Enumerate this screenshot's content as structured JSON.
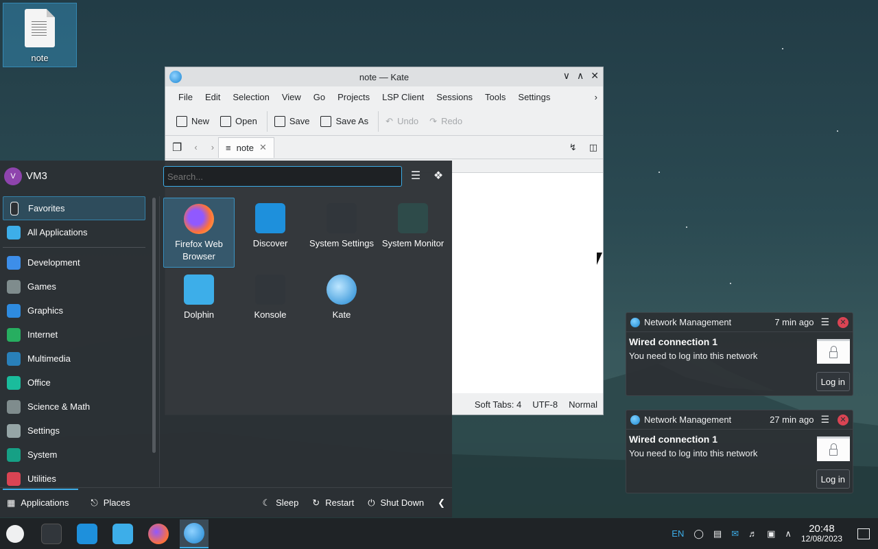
{
  "desktop": {
    "icon_label": "note"
  },
  "kate": {
    "title": "note — Kate",
    "menus": [
      "File",
      "Edit",
      "Selection",
      "View",
      "Go",
      "Projects",
      "LSP Client",
      "Sessions",
      "Tools",
      "Settings"
    ],
    "toolbar": {
      "new": "New",
      "open": "Open",
      "save": "Save",
      "save_as": "Save As",
      "undo": "Undo",
      "redo": "Redo"
    },
    "tab": "note",
    "status": {
      "tabs": "Soft Tabs: 4",
      "encoding": "UTF-8",
      "mode": "Normal"
    }
  },
  "launcher": {
    "user": "VM3",
    "avatar_letter": "V",
    "search_placeholder": "Search...",
    "categories": [
      {
        "label": "Favorites",
        "icon": "bookmark-icon",
        "color": "#2c3034"
      },
      {
        "label": "All Applications",
        "icon": "grid-icon",
        "color": "#3daee9"
      },
      {
        "label": "Development",
        "icon": "code-icon",
        "color": "#3d8ee9"
      },
      {
        "label": "Games",
        "icon": "gamepad-icon",
        "color": "#7f8c8d"
      },
      {
        "label": "Graphics",
        "icon": "graphics-icon",
        "color": "#2e8be0"
      },
      {
        "label": "Internet",
        "icon": "globe-icon",
        "color": "#27ae60"
      },
      {
        "label": "Multimedia",
        "icon": "multimedia-icon",
        "color": "#2980b9"
      },
      {
        "label": "Office",
        "icon": "office-icon",
        "color": "#1abc9c"
      },
      {
        "label": "Science & Math",
        "icon": "flask-icon",
        "color": "#7f8c8d"
      },
      {
        "label": "Settings",
        "icon": "settings-icon",
        "color": "#95a5a6"
      },
      {
        "label": "System",
        "icon": "system-icon",
        "color": "#16a085"
      },
      {
        "label": "Utilities",
        "icon": "toolbox-icon",
        "color": "#da4453"
      }
    ],
    "apps": [
      {
        "name": "Firefox Web Browser",
        "icon": "firefox-icon",
        "color": "#ff7139"
      },
      {
        "name": "Discover",
        "icon": "shopping-bag-icon",
        "color": "#1e90dc"
      },
      {
        "name": "System Settings",
        "icon": "sliders-icon",
        "color": "#31363b"
      },
      {
        "name": "System Monitor",
        "icon": "monitor-icon",
        "color": "#2e4b4a"
      },
      {
        "name": "Dolphin",
        "icon": "folder-icon",
        "color": "#3daee9"
      },
      {
        "name": "Konsole",
        "icon": "terminal-icon",
        "color": "#31363b"
      },
      {
        "name": "Kate",
        "icon": "kate-icon",
        "color": "#1d86d2"
      }
    ],
    "footer": {
      "applications": "Applications",
      "places": "Places",
      "sleep": "Sleep",
      "restart": "Restart",
      "shutdown": "Shut Down"
    }
  },
  "notifications": [
    {
      "app": "Network Management",
      "time": "7 min ago",
      "title": "Wired connection 1",
      "body": "You need to log into this network",
      "action": "Log in"
    },
    {
      "app": "Network Management",
      "time": "27 min ago",
      "title": "Wired connection 1",
      "body": "You need to log into this network",
      "action": "Log in"
    }
  ],
  "taskbar": {
    "language": "EN",
    "time": "20:48",
    "date": "12/08/2023"
  }
}
